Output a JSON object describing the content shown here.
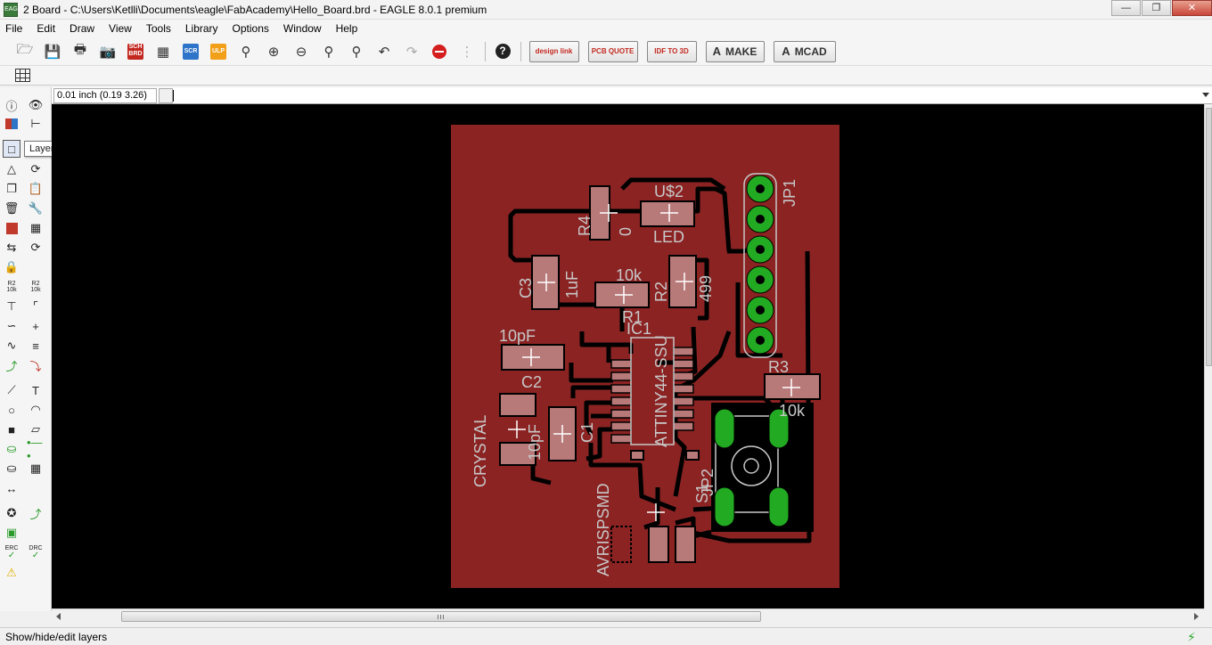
{
  "window": {
    "title": "2 Board - C:\\Users\\Ketlli\\Documents\\eagle\\FabAcademy\\Hello_Board.brd - EAGLE 8.0.1 premium",
    "app_icon_text": "EAGLE"
  },
  "menu": [
    "File",
    "Edit",
    "Draw",
    "View",
    "Tools",
    "Library",
    "Options",
    "Window",
    "Help"
  ],
  "toolbar": {
    "sch_brd_label": "SCH BRD",
    "scr_label": "SCR",
    "ulp_label": "ULP",
    "design_link_label": "design link",
    "pcb_quote_label": "PCB QUOTE",
    "idf_label": "IDF TO 3D",
    "make_label": "MAKE",
    "mcad_label": "MCAD"
  },
  "coord": {
    "readout": "0.01 inch (0.19 3.26)",
    "command_value": ""
  },
  "left_tools": {
    "r2_label": "R2",
    "r2_value": "10k",
    "erc_label": "ERC",
    "drc_label": "DRC"
  },
  "tooltip": "Layer settings...",
  "board": {
    "labels": {
      "r4": "R4",
      "r4_value": "0",
      "u2": "U$2",
      "led": "LED",
      "jp1": "JP1",
      "c3": "C3",
      "c3_value": "1uF",
      "r1_value": "10k",
      "r1": "R1",
      "r2": "R2",
      "r2_value": "499",
      "ic1": "IC1",
      "c2_value": "10pF",
      "c2": "C2",
      "r3": "R3",
      "r3_value": "10k",
      "crystal": "CRYSTAL",
      "c1_value": "10pF",
      "c1": "C1",
      "ic1_value": "ATTINY44-SSU",
      "s1": "S1",
      "jp2": "JP2",
      "avrisp": "AVRISPSMD"
    },
    "colors": {
      "board_fill": "#8b2323",
      "trace": "#000000",
      "pad": "#b87979",
      "label": "#c8c8c8",
      "via": "#22aa22"
    }
  },
  "status": {
    "text": "Show/hide/edit layers"
  }
}
